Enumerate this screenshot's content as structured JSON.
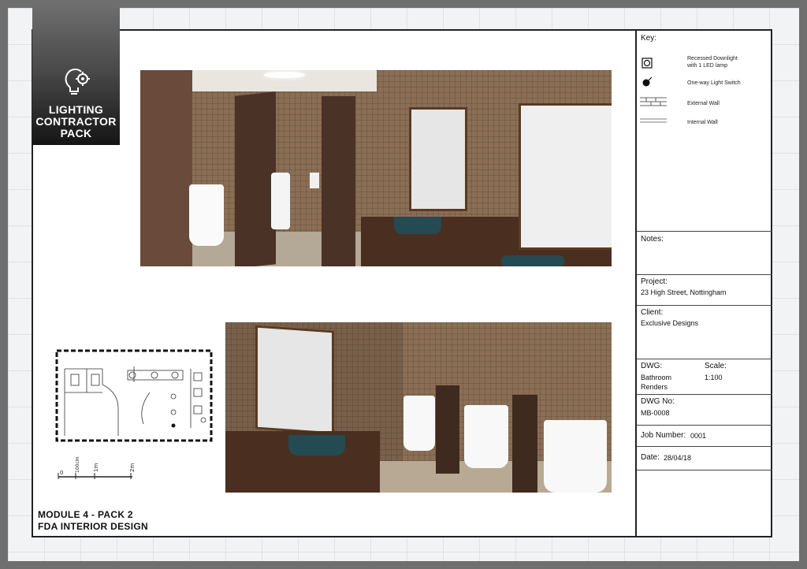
{
  "badge": {
    "line1": "LIGHTING",
    "line2": "CONTRACTOR",
    "line3": "PACK"
  },
  "key": {
    "title": "Key:",
    "items": [
      {
        "label_line1": "Recessed Downlight",
        "label_line2": "with 1 LED lamp",
        "icon": "downlight-icon"
      },
      {
        "label_line1": "One-way Light Switch",
        "label_line2": "",
        "icon": "light-switch-icon"
      },
      {
        "label_line1": "External Wall",
        "label_line2": "",
        "icon": "external-wall-icon"
      },
      {
        "label_line1": "Internal Wall",
        "label_line2": "",
        "icon": "internal-wall-icon"
      }
    ]
  },
  "notes": {
    "label": "Notes:"
  },
  "project": {
    "label": "Project:",
    "value": "23 High Street, Nottingham"
  },
  "client": {
    "label": "Client:",
    "value": "Exclusive Designs"
  },
  "dwg": {
    "label": "DWG:",
    "value_line1": "Bathroom",
    "value_line2": "Renders"
  },
  "scale": {
    "label": "Scale:",
    "value": "1:100"
  },
  "dwg_no": {
    "label": "DWG No:",
    "value": "MB-0008"
  },
  "job": {
    "label": "Job Number:",
    "value": "0001"
  },
  "date": {
    "label": "Date:",
    "value": "28/04/18"
  },
  "scale_bar": {
    "labels": [
      "0",
      "100cm",
      "1m",
      "2m"
    ]
  },
  "footer": {
    "line1": "MODULE 4 - PACK 2",
    "line2": "FDA INTERIOR DESIGN"
  },
  "colors": {
    "frame": "#222222",
    "tile": "#8a6e55",
    "panel_wood": "#4a3226",
    "basin": "#244a52"
  }
}
